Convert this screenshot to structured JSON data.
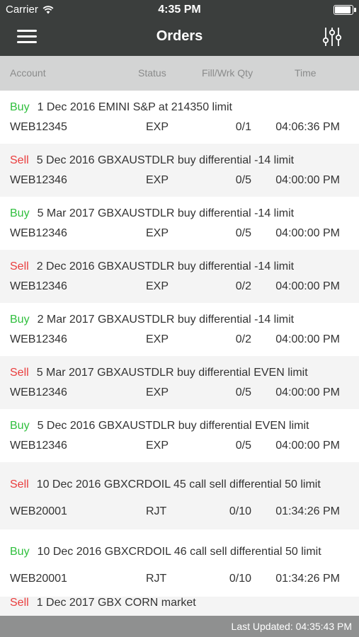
{
  "status_bar": {
    "carrier": "Carrier",
    "time": "4:35 PM"
  },
  "nav": {
    "title": "Orders"
  },
  "columns": {
    "account": "Account",
    "status": "Status",
    "fill_qty": "Fill/Wrk Qty",
    "time": "Time"
  },
  "orders": [
    {
      "side": "Buy",
      "description": "1 Dec 2016 EMINI S&P at 214350 limit",
      "account": "WEB12345",
      "status": "EXP",
      "qty": "0/1",
      "time": "04:06:36 PM"
    },
    {
      "side": "Sell",
      "description": "5 Dec 2016 GBXAUSTDLR buy differential -14 limit",
      "account": "WEB12346",
      "status": "EXP",
      "qty": "0/5",
      "time": "04:00:00 PM"
    },
    {
      "side": "Buy",
      "description": "5 Mar 2017 GBXAUSTDLR buy differential -14 limit",
      "account": "WEB12346",
      "status": "EXP",
      "qty": "0/5",
      "time": "04:00:00 PM"
    },
    {
      "side": "Sell",
      "description": "2 Dec 2016 GBXAUSTDLR buy differential -14 limit",
      "account": "WEB12346",
      "status": "EXP",
      "qty": "0/2",
      "time": "04:00:00 PM"
    },
    {
      "side": "Buy",
      "description": "2 Mar 2017 GBXAUSTDLR buy differential -14 limit",
      "account": "WEB12346",
      "status": "EXP",
      "qty": "0/2",
      "time": "04:00:00 PM"
    },
    {
      "side": "Sell",
      "description": "5 Mar 2017 GBXAUSTDLR buy differential EVEN limit",
      "account": "WEB12346",
      "status": "EXP",
      "qty": "0/5",
      "time": "04:00:00 PM"
    },
    {
      "side": "Buy",
      "description": "5 Dec 2016 GBXAUSTDLR buy differential EVEN limit",
      "account": "WEB12346",
      "status": "EXP",
      "qty": "0/5",
      "time": "04:00:00 PM"
    },
    {
      "side": "Sell",
      "description": "10 Dec 2016 GBXCRDOIL 45 call sell differential 50 limit",
      "account": "WEB20001",
      "status": "RJT",
      "qty": "0/10",
      "time": "01:34:26 PM"
    },
    {
      "side": "Buy",
      "description": "10 Dec 2016 GBXCRDOIL 46 call sell differential 50 limit",
      "account": "WEB20001",
      "status": "RJT",
      "qty": "0/10",
      "time": "01:34:26 PM"
    },
    {
      "side": "Sell",
      "description": "1 Dec 2017 GBX CORN market",
      "account": "",
      "status": "",
      "qty": "",
      "time": ""
    }
  ],
  "footer": {
    "last_updated": "Last Updated: 04:35:43 PM"
  },
  "colors": {
    "buy": "#2fbf3d",
    "sell": "#ea3d3d",
    "nav_bg": "#3b3e3d",
    "header_bg": "#d3d4d4",
    "footer_bg": "#8f9090",
    "row_alt": "#f4f4f4"
  },
  "icons": {
    "menu": "hamburger-icon",
    "filter": "sliders-icon",
    "wifi": "wifi-icon",
    "battery": "battery-icon"
  }
}
